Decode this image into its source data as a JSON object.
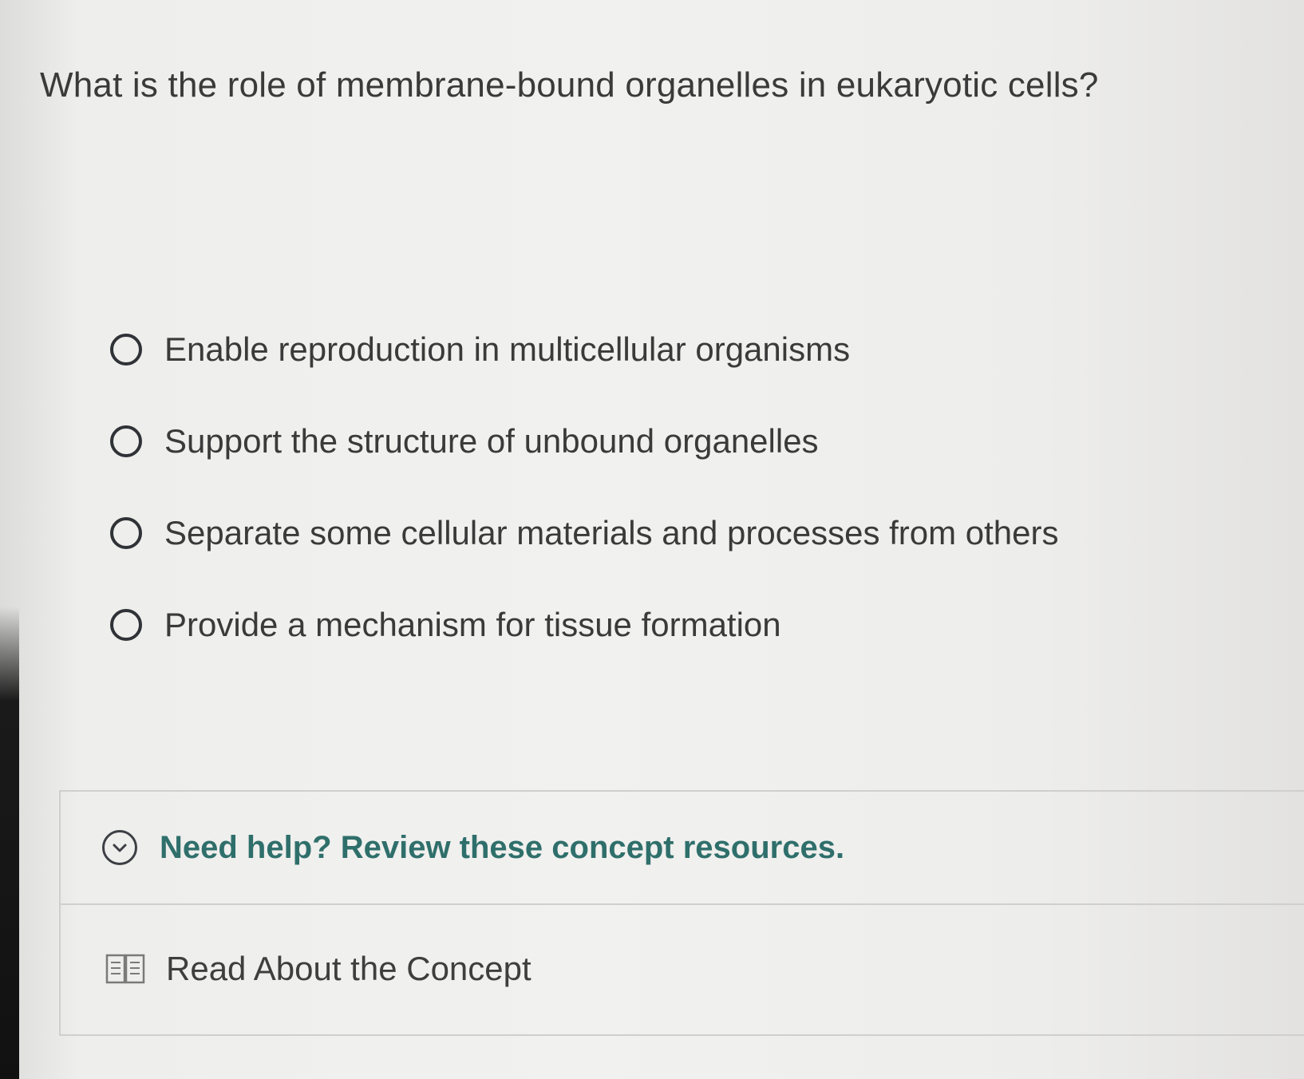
{
  "question": {
    "text": "What is the role of membrane-bound organelles in eukaryotic cells?"
  },
  "options": [
    {
      "label": "Enable reproduction in multicellular organisms"
    },
    {
      "label": "Support the structure of unbound organelles"
    },
    {
      "label": "Separate some cellular materials and processes from others"
    },
    {
      "label": "Provide a mechanism for tissue formation"
    }
  ],
  "help": {
    "title": "Need help? Review these concept resources.",
    "resources": [
      {
        "label": "Read About the Concept",
        "icon": "book-icon"
      }
    ]
  },
  "colors": {
    "help_title": "#2f6f6b",
    "text": "#3a3a3a"
  }
}
